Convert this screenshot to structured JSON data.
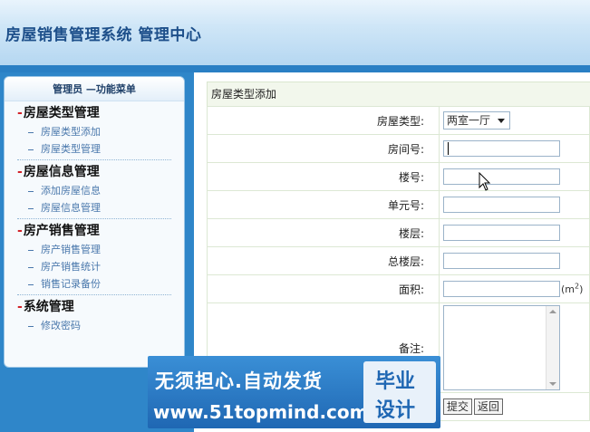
{
  "header": {
    "title": "房屋销售管理系统  管理中心"
  },
  "sidebar": {
    "heading": "管理员  —功能菜单",
    "groups": [
      {
        "title": "房屋类型管理",
        "items": [
          "房屋类型添加",
          "房屋类型管理"
        ]
      },
      {
        "title": "房屋信息管理",
        "items": [
          "添加房屋信息",
          "房屋信息管理"
        ]
      },
      {
        "title": "房产销售管理",
        "items": [
          "房产销售管理",
          "房产销售统计",
          "销售记录备份"
        ]
      },
      {
        "title": "系统管理",
        "items": [
          "修改密码"
        ]
      }
    ]
  },
  "main": {
    "heading": "房屋类型添加",
    "form": {
      "house_type_label": "房屋类型:",
      "house_type_value": "两室一厅",
      "room_no_label": "房间号:",
      "building_no_label": "楼号:",
      "unit_no_label": "单元号:",
      "floor_label": "楼层:",
      "total_floors_label": "总楼层:",
      "area_label": "面积:",
      "area_unit": "m",
      "area_unit_sup": "2",
      "remark_label": "备注:",
      "submit_label": "提交",
      "back_label": "返回"
    }
  },
  "watermark": {
    "line1": "无须担心.自动发货",
    "line2": "www.51topmind.com",
    "logo_line1": "毕业",
    "logo_line2": "设计"
  }
}
